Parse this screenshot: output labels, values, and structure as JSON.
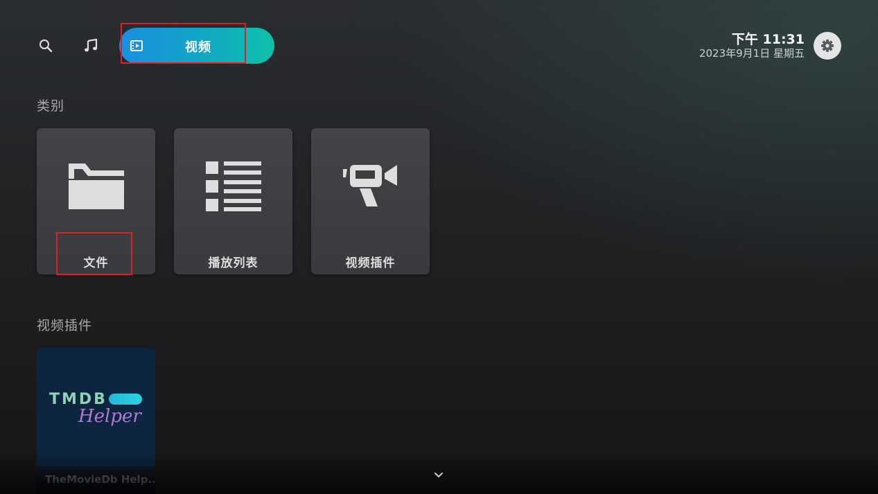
{
  "topbar": {
    "search_icon": "search-icon",
    "music_icon": "music-note-icon",
    "active_tab": {
      "icon": "film-icon",
      "label": "视频"
    },
    "time": "下午 11:31",
    "date": "2023年9月1日 星期五",
    "settings_icon": "gear-icon"
  },
  "categories": {
    "title": "类别",
    "items": [
      {
        "label": "文件",
        "icon": "folder-icon"
      },
      {
        "label": "播放列表",
        "icon": "list-icon"
      },
      {
        "label": "视频插件",
        "icon": "video-camera-icon"
      }
    ]
  },
  "addons": {
    "title": "视频插件",
    "items": [
      {
        "logo_line1": "TMDB",
        "logo_line2": "Helper",
        "caption": "TheMovieDb Help..."
      }
    ]
  },
  "colors": {
    "accent_start": "#1a8fe0",
    "accent_end": "#0fc0a8",
    "highlight": "#e02020"
  }
}
